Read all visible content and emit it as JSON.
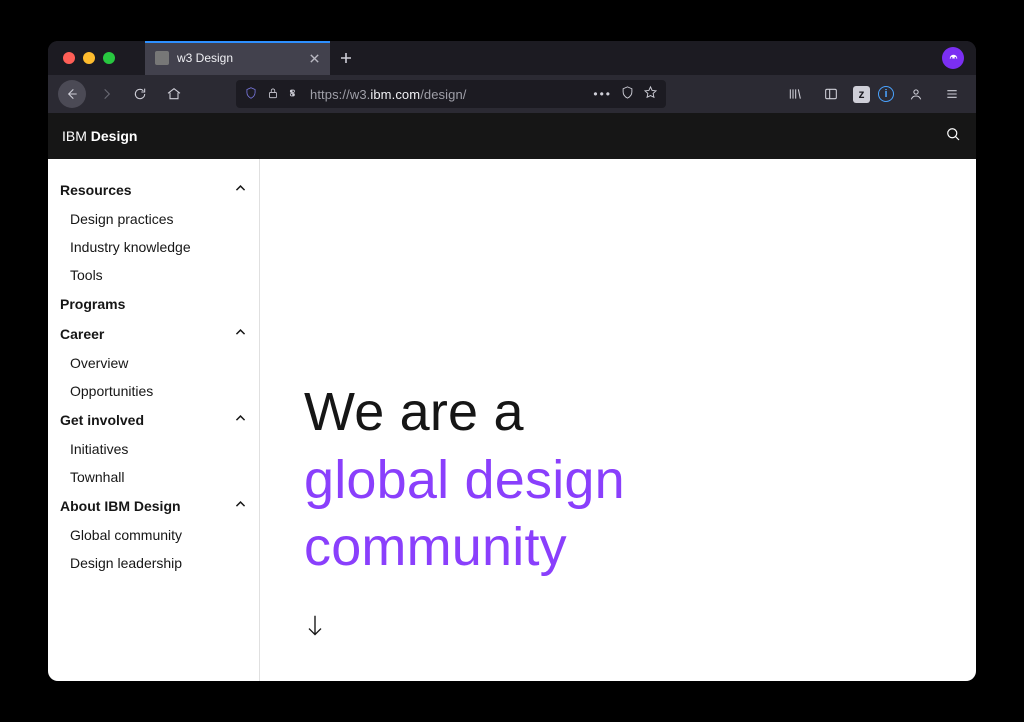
{
  "browser": {
    "tab_title": "w3 Design",
    "url_prefix": "https://",
    "url_host_pre": "w3.",
    "url_host_strong": "ibm.com",
    "url_path": "/design/",
    "z_badge": "z"
  },
  "site_header": {
    "brand_light": "IBM ",
    "brand_bold": "Design"
  },
  "sidenav": {
    "sections": [
      {
        "label": "Resources",
        "expandable": true,
        "items": [
          "Design practices",
          "Industry knowledge",
          "Tools"
        ]
      },
      {
        "label": "Programs",
        "expandable": false,
        "items": []
      },
      {
        "label": "Career",
        "expandable": true,
        "items": [
          "Overview",
          "Opportunities"
        ]
      },
      {
        "label": "Get involved",
        "expandable": true,
        "items": [
          "Initiatives",
          "Townhall"
        ]
      },
      {
        "label": "About IBM Design",
        "expandable": true,
        "items": [
          "Global community",
          "Design leadership"
        ]
      }
    ]
  },
  "hero": {
    "line1": "We are a",
    "line2": "global design",
    "line3": "community"
  },
  "colors": {
    "accent": "#8a3ffc"
  }
}
